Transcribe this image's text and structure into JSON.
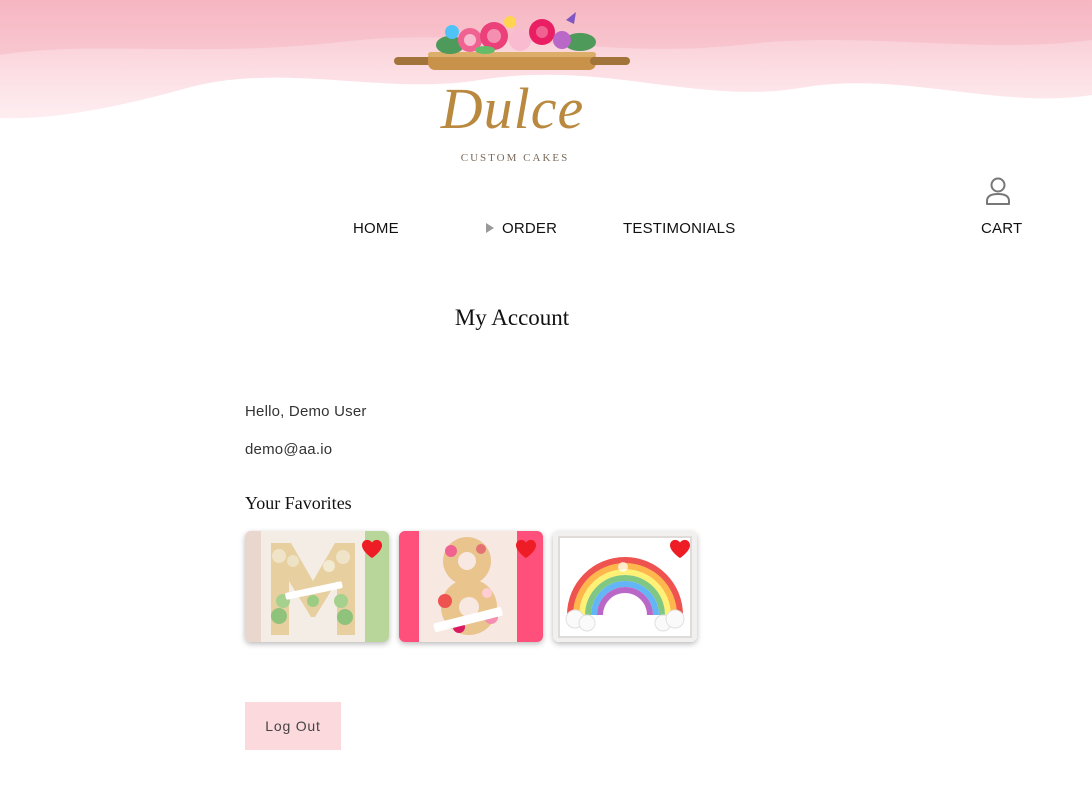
{
  "brand": {
    "name": "Dulce",
    "tagline": "CUSTOM CAKES"
  },
  "nav": {
    "home": "HOME",
    "order": "ORDER",
    "testimonials": "TESTIMONIALS",
    "cart": "CART"
  },
  "account": {
    "title": "My Account",
    "greeting": "Hello, Demo User",
    "email": "demo@aa.io",
    "favorites_title": "Your Favorites",
    "logout_label": "Log Out"
  },
  "favorites": [
    {
      "icon": "heart-icon",
      "favorited": true
    },
    {
      "icon": "heart-icon",
      "favorited": true
    },
    {
      "icon": "heart-icon",
      "favorited": true
    }
  ],
  "colors": {
    "accent_pink": "#fbd9dd",
    "heart_red": "#ee1c24",
    "logo_gold": "#b8893f"
  }
}
